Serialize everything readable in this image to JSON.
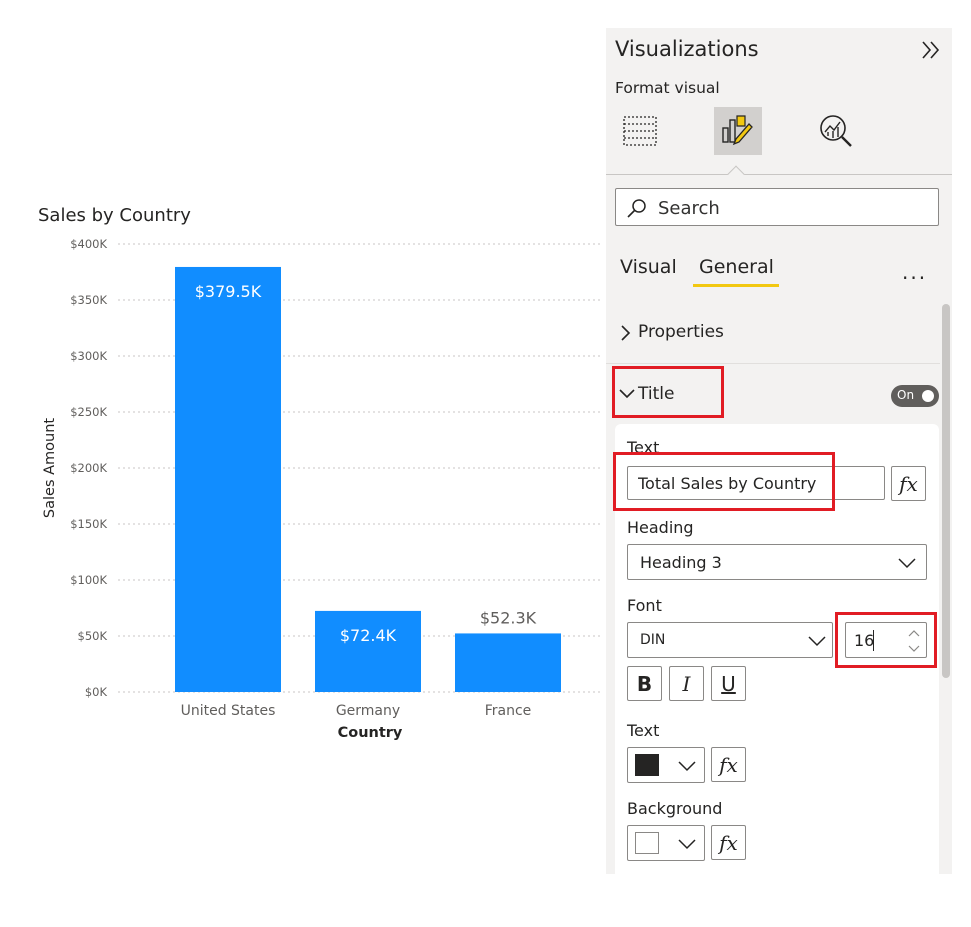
{
  "chart_data": {
    "type": "bar",
    "title": "Sales by Country",
    "xlabel": "Country",
    "ylabel": "Sales Amount",
    "categories": [
      "United States",
      "Germany",
      "France"
    ],
    "values": [
      379.5,
      72.4,
      52.3
    ],
    "data_labels": [
      "$379.5K",
      "$72.4K",
      "$52.3K"
    ],
    "y_ticks": [
      0,
      50,
      100,
      150,
      200,
      250,
      300,
      350,
      400
    ],
    "y_tick_labels": [
      "$0K",
      "$50K",
      "$100K",
      "$150K",
      "$200K",
      "$250K",
      "$300K",
      "$350K",
      "$400K"
    ],
    "ylim": [
      0,
      400
    ],
    "grid": true,
    "bar_color": "#118dff"
  },
  "pane": {
    "title": "Visualizations",
    "format_visual": "Format visual",
    "search_placeholder": "Search",
    "tabs": [
      "Visual",
      "General"
    ],
    "active_tab": "General",
    "more": "...",
    "sections": {
      "properties": "Properties",
      "title": "Title"
    },
    "title_toggle": "On",
    "title_card": {
      "text_label": "Text",
      "text_value": "Total Sales by Country",
      "fx": "fx",
      "heading_label": "Heading",
      "heading_value": "Heading 3",
      "font_label": "Font",
      "font_family": "DIN",
      "font_size": "16",
      "bold": "B",
      "italic": "I",
      "underline": "U",
      "text_color_label": "Text",
      "text_color": "#252423",
      "background_label": "Background",
      "background_color": "#ffffff"
    }
  },
  "colors": {
    "accent": "#f2c811",
    "highlight": "#e11c24"
  }
}
